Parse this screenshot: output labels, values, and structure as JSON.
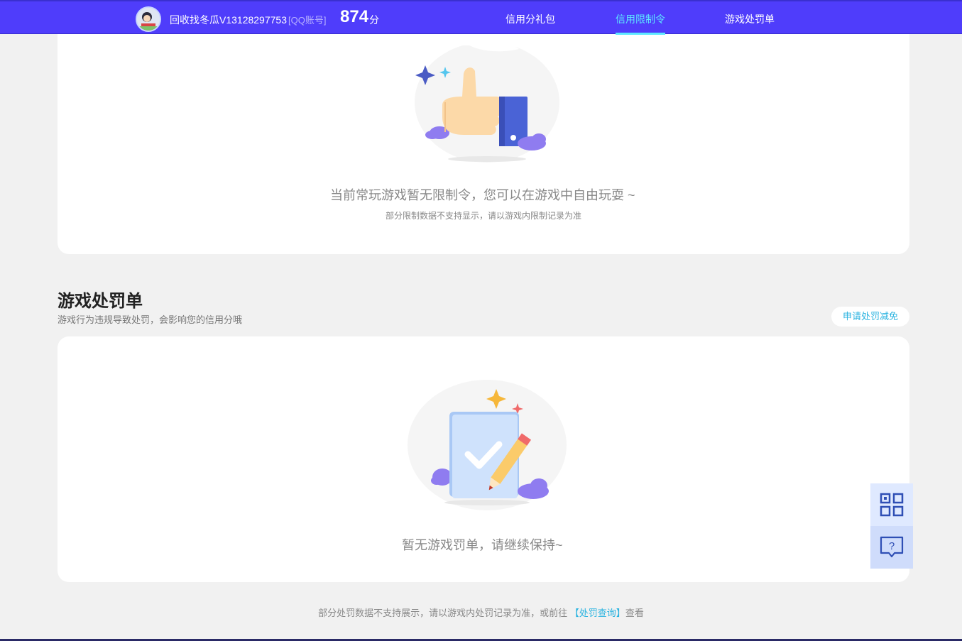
{
  "header": {
    "username": "回收找冬瓜V13128297753",
    "account_type": "[QQ账号]",
    "score": "874",
    "score_unit": "分",
    "nav": [
      {
        "label": "信用分礼包",
        "active": false
      },
      {
        "label": "信用限制令",
        "active": true
      },
      {
        "label": "游戏处罚单",
        "active": false
      }
    ]
  },
  "restriction": {
    "empty_message": "当前常玩游戏暂无限制令，您可以在游戏中自由玩耍 ~",
    "note": "部分限制数据不支持显示，请以游戏内限制记录为准"
  },
  "penalty": {
    "title": "游戏处罚单",
    "subtitle": "游戏行为违规导致处罚，会影响您的信用分哦",
    "apply_button": "申请处罚减免",
    "empty_message": "暂无游戏罚单，请继续保持~"
  },
  "footer": {
    "note_prefix": "部分处罚数据不支持展示，请以游戏内处罚记录为准，或前往 ",
    "link": "【处罚查询】",
    "note_suffix": "查看"
  },
  "side_tools": [
    {
      "icon": "qr-code-icon"
    },
    {
      "icon": "help-chat-icon"
    }
  ],
  "colors": {
    "header_bg": "#4f3dfb",
    "active_nav": "#5de8ff",
    "link": "#2ab3e0"
  }
}
